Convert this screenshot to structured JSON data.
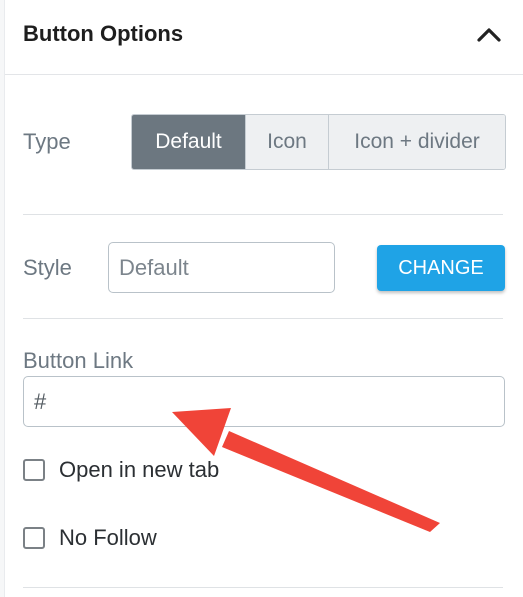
{
  "header": {
    "title": "Button Options",
    "toggle_icon": "chevron-up-icon"
  },
  "type": {
    "label": "Type",
    "options": [
      "Default",
      "Icon",
      "Icon + divider"
    ],
    "selected": "Default"
  },
  "style": {
    "label": "Style",
    "value": "Default",
    "change_label": "CHANGE"
  },
  "button_link": {
    "label": "Button Link",
    "value": "#"
  },
  "checkboxes": [
    {
      "label": "Open in new tab",
      "checked": false
    },
    {
      "label": "No Follow",
      "checked": false
    }
  ],
  "colors": {
    "accent": "#1fa3e6",
    "active_segment": "#6c7780",
    "annotation_arrow": "#f04438"
  }
}
